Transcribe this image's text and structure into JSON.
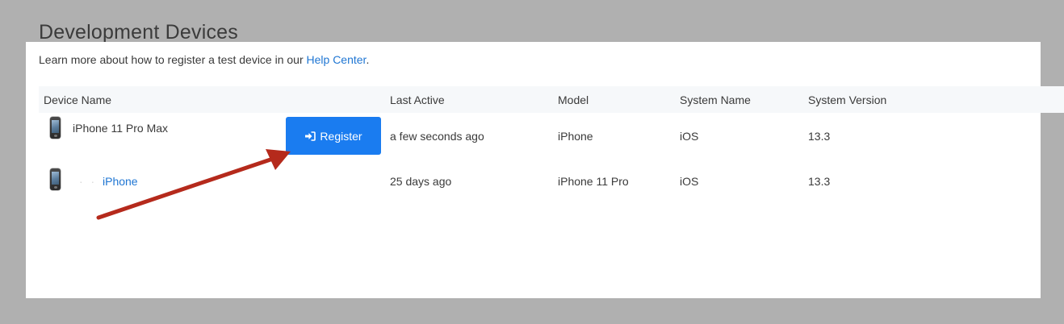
{
  "page": {
    "title": "Development Devices"
  },
  "intro": {
    "text": "Learn more about how to register a test device in our ",
    "link": "Help Center",
    "suffix": "."
  },
  "table": {
    "columns": [
      "Device Name",
      "Last Active",
      "Model",
      "System Name",
      "System Version"
    ],
    "rows": [
      {
        "device_name": "iPhone 11 Pro Max",
        "last_active": "a few seconds ago",
        "model": "iPhone",
        "system_name": "iOS",
        "system_version": "13.3",
        "action_label": "Register",
        "icon": "iphone-icon"
      },
      {
        "device_name": "iPhone",
        "last_active": "25 days ago",
        "model": "iPhone 11 Pro",
        "system_name": "iOS",
        "system_version": "13.3",
        "icon": "iphone-icon"
      }
    ]
  },
  "annotation": {
    "icon": "red-arrow-annotation",
    "color": "#b52a1c"
  },
  "colors": {
    "primary_button": "#1a7cf0",
    "link": "#1f76d3",
    "header_bg": "#f6f8fa",
    "backdrop": "#b0b0b0"
  }
}
